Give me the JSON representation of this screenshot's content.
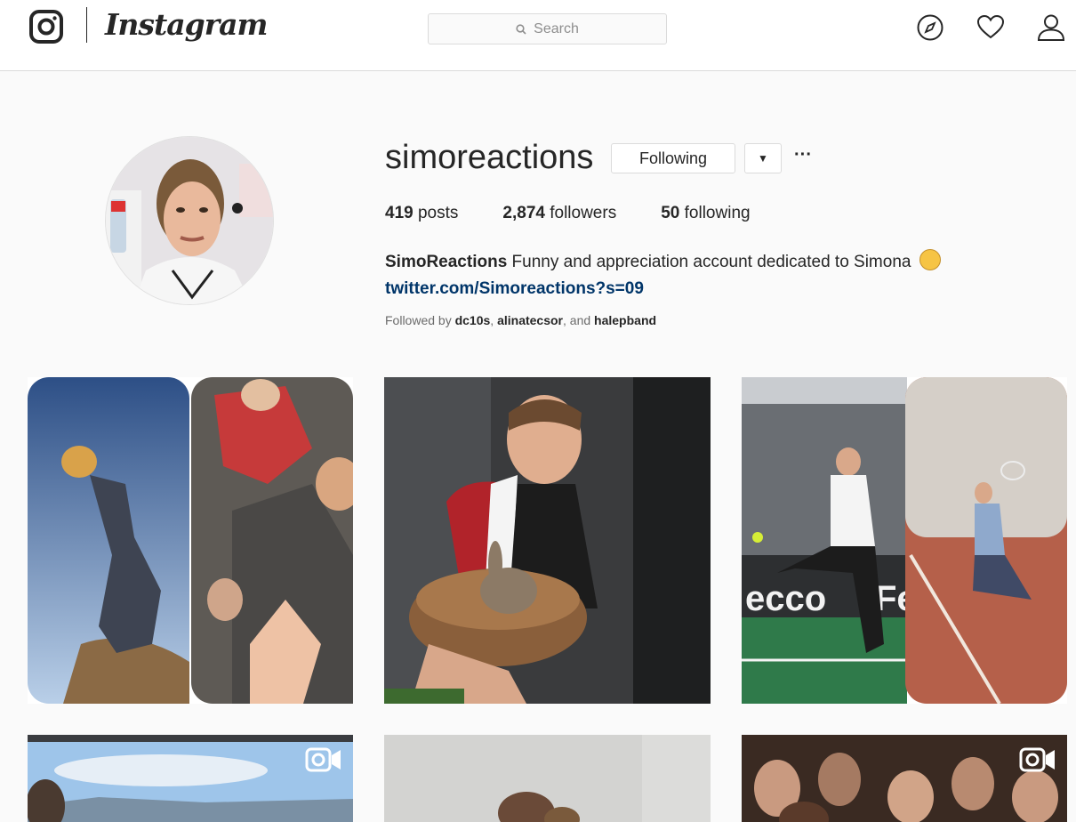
{
  "nav": {
    "brand": "Instagram",
    "search_placeholder": "Search"
  },
  "profile": {
    "username": "simoreactions",
    "follow_button_label": "Following",
    "stats": {
      "posts_count": "419",
      "posts_label": "posts",
      "followers_count": "2,874",
      "followers_label": "followers",
      "following_count": "50",
      "following_label": "following"
    },
    "bio": {
      "name": "SimoReactions",
      "text": "Funny and appreciation account dedicated to Simona",
      "link": "twitter.com/Simoreactions?s=09"
    },
    "followed_by": {
      "prefix": "Followed by",
      "user1": "dc10s",
      "user2": "alinatecsor",
      "conjunction": ", and",
      "user3": "halepband"
    }
  },
  "posts": [
    {
      "kind": "image",
      "subject": "lion-king-split"
    },
    {
      "kind": "image",
      "subject": "player-with-rabbit"
    },
    {
      "kind": "image",
      "subject": "tennis-split"
    },
    {
      "kind": "video",
      "subject": "outdoor-sky"
    },
    {
      "kind": "image",
      "subject": "indoor-crowd-light"
    },
    {
      "kind": "video",
      "subject": "crowd-dark"
    }
  ],
  "colors": {
    "background": "#fafafa",
    "text": "#262626",
    "link": "#003569",
    "border": "#dbdbdb"
  }
}
